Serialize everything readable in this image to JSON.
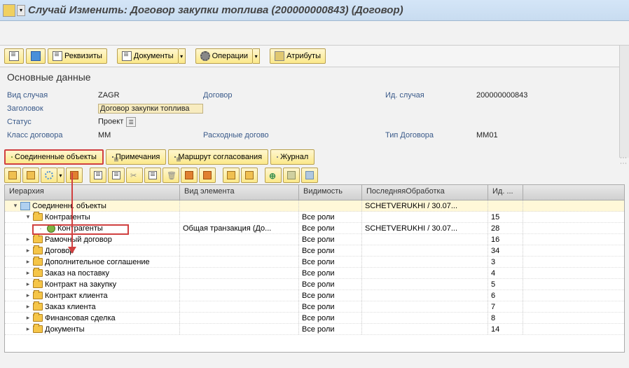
{
  "title": "Случай Изменить: Договор закупки топлива (200000000843) (Договор)",
  "toolbar": {
    "rekv": "Реквизиты",
    "docs": "Документы",
    "ops": "Операции",
    "attrs": "Атрибуты"
  },
  "section_main": "Основные данные",
  "form": {
    "case_type_l": "Вид случая",
    "case_type_v": "ZAGR",
    "header_l": "Заголовок",
    "header_v": "Договор закупки топлива",
    "status_l": "Статус",
    "status_v": "Проект",
    "class_l": "Класс договора",
    "class_v": "MM",
    "dogovor_l": "Договор",
    "rashodn_l": "Расходные догово",
    "id_case_l": "Ид. случая",
    "id_case_v": "200000000843",
    "type_dog_l": "Тип Договора",
    "type_dog_v": "MM01"
  },
  "tabs": {
    "connected": "Соединенные объекты",
    "notes": "Примечания",
    "route": "Маршрут согласования",
    "journal": "Журнал"
  },
  "tree_hdr": {
    "hier": "Иерархия",
    "type": "Вид элемента",
    "vis": "Видимость",
    "last": "ПоследняяОбработка",
    "id": "Ид. ..."
  },
  "tree": [
    {
      "ind": 0,
      "exp": "▾",
      "icon": "obj",
      "label": "Соединенн. объекты",
      "type": "",
      "vis": "",
      "last": "SCHETVERUKHI / 30.07...",
      "id": "",
      "sel": true
    },
    {
      "ind": 1,
      "exp": "▾",
      "icon": "folder",
      "label": "Контрагенты",
      "type": "",
      "vis": "Все роли",
      "last": "",
      "id": "15"
    },
    {
      "ind": 2,
      "exp": "·",
      "icon": "link",
      "label": "Контрагенты",
      "type": "Общая транзакция (До...",
      "vis": "Все роли",
      "last": "SCHETVERUKHI / 30.07...",
      "id": "28",
      "hl": true
    },
    {
      "ind": 1,
      "exp": "▸",
      "icon": "folder",
      "label": "Рамочный договор",
      "type": "",
      "vis": "Все роли",
      "last": "",
      "id": "16"
    },
    {
      "ind": 1,
      "exp": "▸",
      "icon": "folder",
      "label": "Договор",
      "type": "",
      "vis": "Все роли",
      "last": "",
      "id": "34"
    },
    {
      "ind": 1,
      "exp": "▸",
      "icon": "folder",
      "label": "Дополнительное соглашение",
      "type": "",
      "vis": "Все роли",
      "last": "",
      "id": "3"
    },
    {
      "ind": 1,
      "exp": "▸",
      "icon": "folder",
      "label": "Заказ на поставку",
      "type": "",
      "vis": "Все роли",
      "last": "",
      "id": "4"
    },
    {
      "ind": 1,
      "exp": "▸",
      "icon": "folder",
      "label": "Контракт на закупку",
      "type": "",
      "vis": "Все роли",
      "last": "",
      "id": "5"
    },
    {
      "ind": 1,
      "exp": "▸",
      "icon": "folder",
      "label": "Контракт клиента",
      "type": "",
      "vis": "Все роли",
      "last": "",
      "id": "6"
    },
    {
      "ind": 1,
      "exp": "▸",
      "icon": "folder",
      "label": "Заказ клиента",
      "type": "",
      "vis": "Все роли",
      "last": "",
      "id": "7"
    },
    {
      "ind": 1,
      "exp": "▸",
      "icon": "folder",
      "label": "Финансовая сделка",
      "type": "",
      "vis": "Все роли",
      "last": "",
      "id": "8"
    },
    {
      "ind": 1,
      "exp": "▸",
      "icon": "folder",
      "label": "Документы",
      "type": "",
      "vis": "Все роли",
      "last": "",
      "id": "14"
    }
  ]
}
